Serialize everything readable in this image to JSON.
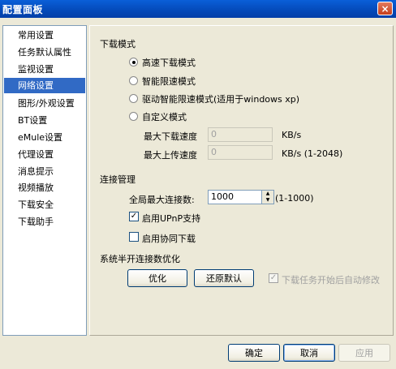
{
  "window": {
    "title": "配置面板",
    "close_glyph": "×"
  },
  "sidebar": {
    "items": [
      {
        "label": "常用设置"
      },
      {
        "label": "任务默认属性"
      },
      {
        "label": "监视设置"
      },
      {
        "label": "网络设置",
        "selected": true
      },
      {
        "label": "图形/外观设置"
      },
      {
        "label": "BT设置"
      },
      {
        "label": "eMule设置"
      },
      {
        "label": "代理设置"
      },
      {
        "label": "消息提示"
      },
      {
        "label": "视频播放"
      },
      {
        "label": "下载安全"
      },
      {
        "label": "下载助手"
      }
    ]
  },
  "download_mode": {
    "title": "下载模式",
    "options": [
      {
        "label": "高速下载模式",
        "checked": true
      },
      {
        "label": "智能限速模式",
        "checked": false
      },
      {
        "label": "驱动智能限速模式(适用于windows xp)",
        "checked": false
      },
      {
        "label": "自定义模式",
        "checked": false
      }
    ],
    "max_download": {
      "label": "最大下载速度",
      "value": "0",
      "unit": "KB/s"
    },
    "max_upload": {
      "label": "最大上传速度",
      "value": "0",
      "unit": "KB/s (1-2048)"
    }
  },
  "connection": {
    "title": "连接管理",
    "max_connections": {
      "label": "全局最大连接数:",
      "value": "1000",
      "range": "(1-1000)"
    },
    "upnp": {
      "label": "启用UPnP支持",
      "checked": true
    },
    "cooperative": {
      "label": "启用协同下载",
      "checked": false
    }
  },
  "half_open": {
    "title": "系统半开连接数优化",
    "optimize_label": "优化",
    "restore_label": "还原默认",
    "auto_modify": {
      "label": "下载任务开始后自动修改",
      "checked": true,
      "disabled": true
    }
  },
  "footer": {
    "ok_label": "确定",
    "cancel_label": "取消",
    "apply_label": "应用"
  },
  "colors": {
    "selection": "#316ac5",
    "titlebar": "#0449b8",
    "dialog_bg": "#ece9d8"
  }
}
